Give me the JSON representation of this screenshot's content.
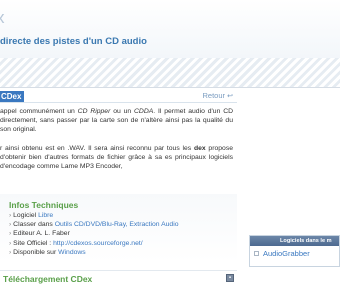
{
  "header": {
    "title": "x",
    "subtitle": "directe des pistes d'un CD audio"
  },
  "article": {
    "title": "CDex",
    "back_label": "Retour",
    "p1_parts": [
      "appel communément un ",
      "CD Ripper",
      " ou un ",
      "CDDA",
      ". Il permet audio d'un CD directement, sans passer par la carte son de n'altère ainsi pas la qualité du son original."
    ],
    "p2_parts": [
      "r ainsi obtenu est en .WAV. Il sera ainsi reconnu par tous les ",
      "dex",
      " propose d'obtenir bien d'autres formats de fichier grâce à sa es principaux logiciels d'encodage comme Lame MP3 Encoder,"
    ]
  },
  "info": {
    "title": "Infos Techniques",
    "items": [
      {
        "label": "Logiciel ",
        "link": "Libre"
      },
      {
        "label": "Classer dans ",
        "link": "Outils CD/DVD/Blu-Ray, Extraction Audio"
      },
      {
        "label": "Editeur A. L. Faber",
        "link": ""
      },
      {
        "label": "Site Officiel : ",
        "link": "http://cdexos.sourceforge.net/"
      },
      {
        "label": "Disponible sur ",
        "link": "Windows"
      }
    ]
  },
  "download": {
    "title": "Téléchargement CDex"
  },
  "sidebar": {
    "box_title": "Logiciels dans le m",
    "items": [
      {
        "label": "AudioGrabber"
      }
    ]
  }
}
